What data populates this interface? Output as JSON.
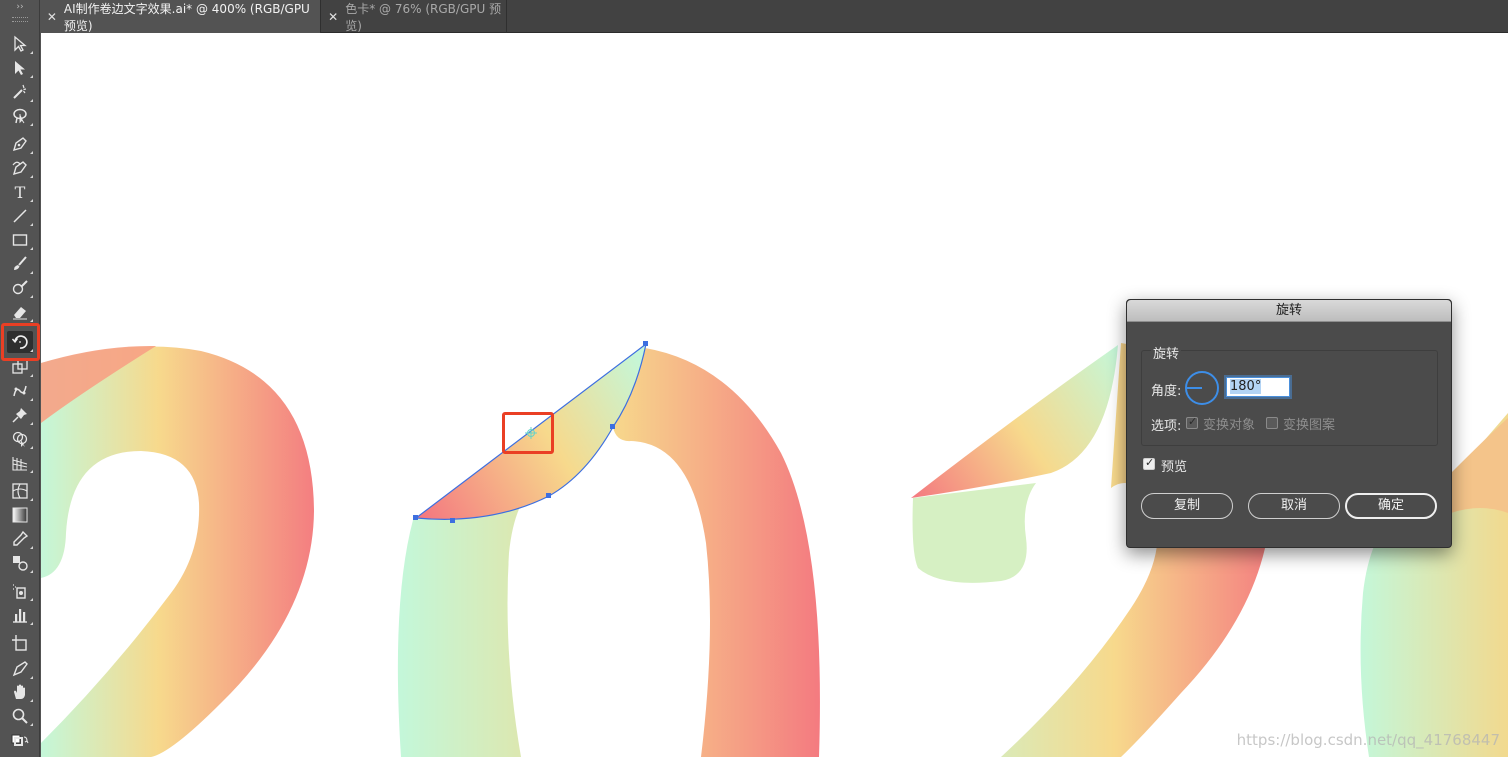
{
  "tabs": [
    {
      "label": "AI制作卷边文字效果.ai* @ 400% (RGB/GPU 预览)",
      "active": true
    },
    {
      "label": "色卡* @ 76% (RGB/GPU 预览)",
      "active": false
    }
  ],
  "toolbar": {
    "collapse_glyph": "››",
    "tools": [
      {
        "name": "selection-tool-icon"
      },
      {
        "name": "direct-selection-tool-icon"
      },
      {
        "name": "magic-wand-tool-icon"
      },
      {
        "name": "lasso-tool-icon"
      },
      {
        "name": "pen-tool-icon"
      },
      {
        "name": "curvature-tool-icon"
      },
      {
        "name": "type-tool-icon",
        "glyph": "T"
      },
      {
        "name": "line-segment-tool-icon"
      },
      {
        "name": "rectangle-tool-icon"
      },
      {
        "name": "paintbrush-tool-icon"
      },
      {
        "name": "shaper-tool-icon"
      },
      {
        "name": "eraser-tool-icon"
      },
      {
        "name": "rotate-tool-icon",
        "selected": true
      },
      {
        "name": "scale-tool-icon"
      },
      {
        "name": "puppet-warp-tool-icon"
      },
      {
        "name": "pin-tool-icon"
      },
      {
        "name": "shape-builder-tool-icon"
      },
      {
        "name": "perspective-grid-tool-icon"
      },
      {
        "name": "mesh-tool-icon"
      },
      {
        "name": "gradient-tool-icon"
      },
      {
        "name": "eyedropper-tool-icon"
      },
      {
        "name": "blend-tool-icon"
      },
      {
        "name": "symbol-sprayer-tool-icon"
      },
      {
        "name": "graph-tool-icon"
      },
      {
        "name": "artboard-tool-icon"
      },
      {
        "name": "slice-tool-icon"
      },
      {
        "name": "hand-tool-icon"
      },
      {
        "name": "zoom-tool-icon"
      },
      {
        "name": "fill-stroke-icon"
      }
    ]
  },
  "dialog": {
    "title": "旋转",
    "group_label": "旋转",
    "angle_label": "角度:",
    "angle_value": "180°",
    "options_label": "选项:",
    "transform_objects": {
      "label": "变换对象",
      "checked": true,
      "enabled": false
    },
    "transform_patterns": {
      "label": "变换图案",
      "checked": false,
      "enabled": false
    },
    "preview": {
      "label": "预览",
      "checked": true
    },
    "buttons": {
      "copy": "复制",
      "cancel": "取消",
      "ok": "确定"
    }
  },
  "watermark": "https://blog.csdn.net/qq_41768447",
  "colors": {
    "gradient_mint": "#c4f7d9",
    "gradient_yellow": "#f7d98c",
    "gradient_coral": "#f47a80",
    "selection_blue": "#3d6fe0",
    "highlight_red": "#ea3f24"
  }
}
